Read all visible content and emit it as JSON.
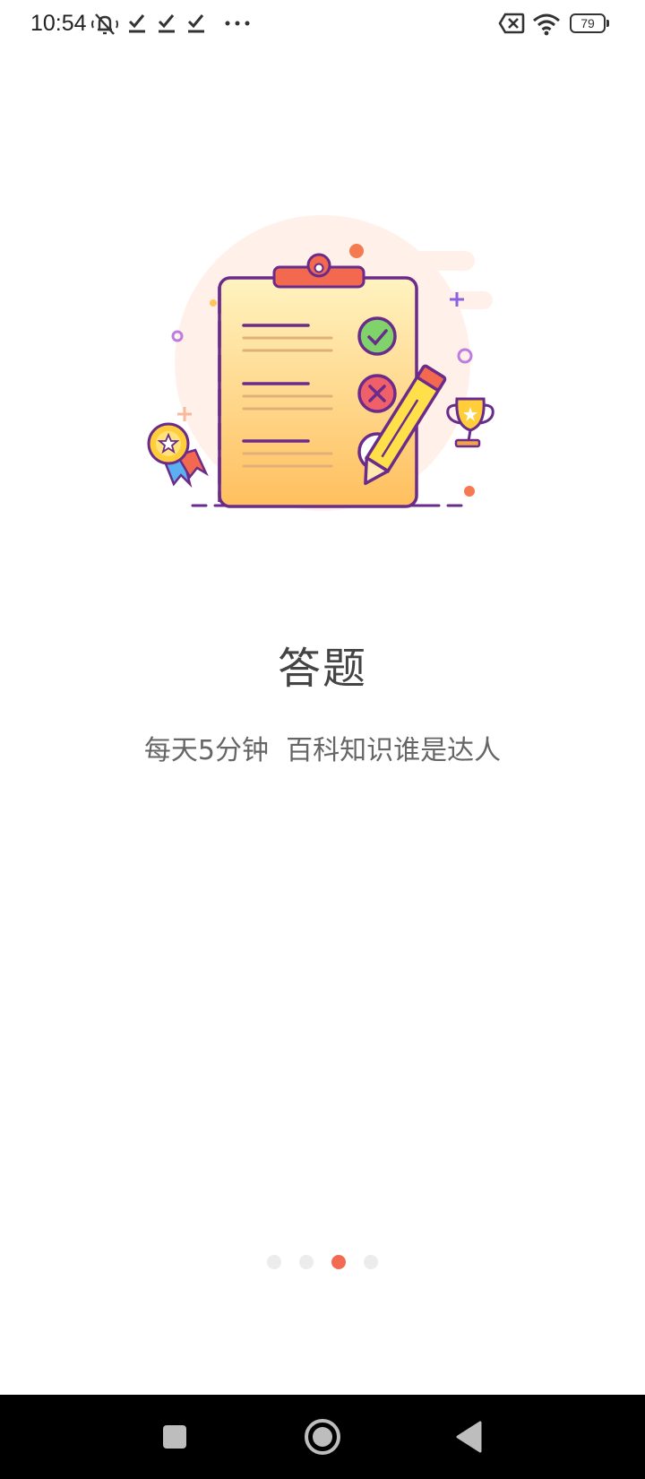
{
  "status_bar": {
    "time": "10:54",
    "icons": [
      "mute-icon",
      "check-icon",
      "check-icon",
      "check-icon",
      "more-icon",
      "no-sim-icon",
      "wifi-icon",
      "battery-icon"
    ],
    "battery": "79"
  },
  "onboarding": {
    "title": "答题",
    "subtitle": "每天5分钟  百科知识谁是达人",
    "pager": {
      "count": 4,
      "active_index": 2
    }
  },
  "navigation": {
    "buttons": [
      "recents-icon",
      "home-icon",
      "back-icon"
    ]
  },
  "colors": {
    "accent": "#f26a50",
    "dot_inactive": "#ececec",
    "purple": "#6a2b8a"
  }
}
